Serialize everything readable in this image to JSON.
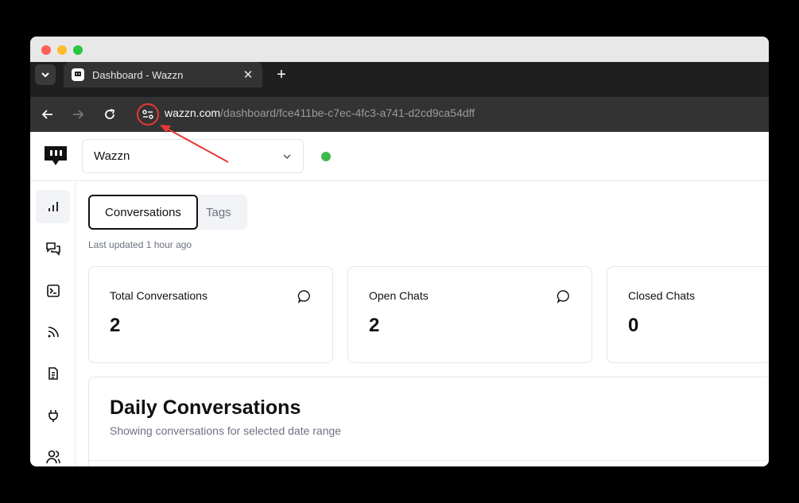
{
  "browser": {
    "tab": {
      "title": "Dashboard - Wazzn",
      "close_label": "✕"
    },
    "new_tab_label": "+",
    "address": {
      "host": "wazzn.com",
      "path": "/dashboard/fce411be-c7ec-4fc3-a741-d2cd9ca54dff"
    }
  },
  "header": {
    "org_select": {
      "value": "Wazzn"
    },
    "status_color": "#3fb950"
  },
  "sidebar": {
    "items": [
      {
        "icon": "bar-chart-icon",
        "active": true
      },
      {
        "icon": "messages-icon"
      },
      {
        "icon": "terminal-icon"
      },
      {
        "icon": "rss-icon"
      },
      {
        "icon": "document-icon"
      },
      {
        "icon": "plug-icon"
      },
      {
        "icon": "users-icon"
      }
    ]
  },
  "main": {
    "tabs": [
      {
        "label": "Conversations"
      },
      {
        "label": "Tags"
      }
    ],
    "last_updated": "Last updated 1 hour ago",
    "stats": [
      {
        "title": "Total Conversations",
        "value": "2"
      },
      {
        "title": "Open Chats",
        "value": "2"
      },
      {
        "title": "Closed Chats",
        "value": "0"
      }
    ],
    "daily": {
      "title": "Daily Conversations",
      "subtitle": "Showing conversations for selected date range"
    }
  },
  "annotation_color": "#e53935"
}
